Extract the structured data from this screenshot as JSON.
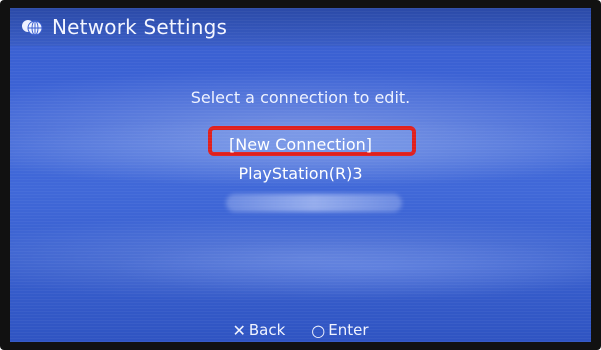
{
  "window": {
    "title": "Network Settings",
    "title_icon": "network-globe-icon"
  },
  "main": {
    "prompt": "Select a connection to edit.",
    "options": [
      {
        "label": "[New Connection]",
        "selected": true
      },
      {
        "label": "PlayStation(R)3",
        "selected": false
      }
    ],
    "highlight_color": "#e0201e"
  },
  "footer": {
    "back": {
      "glyph": "✕",
      "label": "Back",
      "icon": "cross-button-icon"
    },
    "enter": {
      "glyph": "○",
      "label": "Enter",
      "icon": "circle-button-icon"
    }
  },
  "colors": {
    "background": "#3c63d6",
    "text": "#ffffff"
  }
}
